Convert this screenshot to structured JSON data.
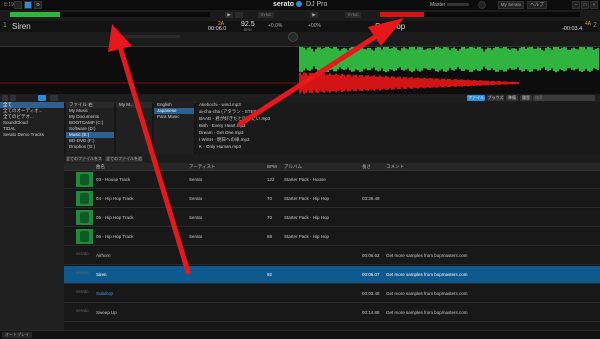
{
  "app": {
    "brand": "serato",
    "product": "DJ Pro",
    "top_left_time": "8:19"
  },
  "topbar": {
    "master_label": "Master",
    "right_buttons": [
      "My Serato",
      "ヘルプ"
    ]
  },
  "deck_left": {
    "title": "Siren",
    "bpm": "92.5",
    "bpm_unit": "BPM",
    "elapsed": "00:06.0",
    "key": "2A",
    "sync": "SYNC",
    "pitch": "+0.0%",
    "overview_color": "#2fb43f",
    "progress": 0.25
  },
  "deck_right": {
    "title": "Subdrop",
    "remaining": "-00:03.4",
    "key": "4A",
    "sync": "SYNC",
    "pitch": "+00%",
    "overview_color": "#d21414",
    "progress": 0.22
  },
  "browser_bar": {
    "buttons": [
      "ファイル",
      "ブラウズ",
      "準備",
      "履歴"
    ],
    "search_placeholder": "検索"
  },
  "crates": [
    {
      "label": "全て",
      "selected": true
    },
    {
      "label": "全てのオーディオ..."
    },
    {
      "label": "全てのビデオ..."
    },
    {
      "label": "SoundCloud"
    },
    {
      "label": "TIDAL"
    },
    {
      "label": "Serato Demo Tracks"
    }
  ],
  "files_panel": {
    "header": "ファイル 右",
    "items": [
      "My Music",
      "My Documents",
      "BOOTCAMP (C:)",
      "Software (D:)",
      "Music (E:)",
      "BD-DVD (F:)",
      "Dropbox (G:)"
    ],
    "selected_index": 4
  },
  "folders_panel": {
    "header": "My M...",
    "items": [
      "English",
      "Japanese",
      "Para Music"
    ],
    "selected_index": 1
  },
  "files_list": [
    "Akebochi - wind.mp3",
    "ai-cha-cha (アタラン - STEP...)",
    "BAAD - 君が好きだと叫びたい.mp3",
    "Bish - Every Heart.mp3",
    "Dream - Get One.mp3",
    "I WiSH - 明日への扉.mp3",
    "K - Only Human.mp3"
  ],
  "library_actions": [
    "全てのファイルをスキャン",
    "全てのファイルを追加"
  ],
  "columns": [
    "曲名",
    "アーティスト",
    "BPM",
    "アルバム",
    "長さ",
    "コメント"
  ],
  "tracks": [
    {
      "art": "green",
      "title": "03 - House Track",
      "artist": "Serato",
      "bpm": "122",
      "album": "Starter Pack - House",
      "length": "",
      "comment": ""
    },
    {
      "art": "green",
      "title": "04 - Hip Hop Track",
      "artist": "Serato",
      "bpm": "70",
      "album": "Starter Pack - Hip Hop",
      "length": "03:39.48",
      "comment": ""
    },
    {
      "art": "green",
      "title": "05 - Hip Hop Track",
      "artist": "Serato",
      "bpm": "70",
      "album": "Starter Pack - Hip Hop",
      "length": "",
      "comment": ""
    },
    {
      "art": "green",
      "title": "06 - Hip Hop Track",
      "artist": "Serato",
      "bpm": "68",
      "album": "Starter Pack - Hip Hop",
      "length": "",
      "comment": ""
    },
    {
      "art": "serato",
      "title": "Airhorn",
      "artist": "",
      "bpm": "",
      "album": "",
      "length": "00:06.62",
      "comment": "Get more samples from bopmasters.com"
    },
    {
      "art": "serato",
      "title": "Siren",
      "artist": "",
      "bpm": "92",
      "album": "",
      "length": "00:06.07",
      "comment": "Get more samples from bopmasters.com",
      "selected": true
    },
    {
      "art": "serato",
      "title": "Subdrop",
      "artist": "",
      "bpm": "",
      "album": "",
      "length": "00:03.48",
      "comment": "Get more samples from bopmasters.com",
      "loaded_blue": true
    },
    {
      "art": "serato",
      "title": "Sweep Up",
      "artist": "",
      "bpm": "",
      "album": "",
      "length": "00:14.88",
      "comment": "Get more samples from bopmasters.com"
    }
  ],
  "statusbar": {
    "label": "オートプレイ"
  },
  "colors": {
    "accent": "#2a8de0",
    "arrow": "#e8171b",
    "selected_row": "#0e5a8f",
    "green_wave": "#2fb43f",
    "red_wave": "#d21414"
  }
}
